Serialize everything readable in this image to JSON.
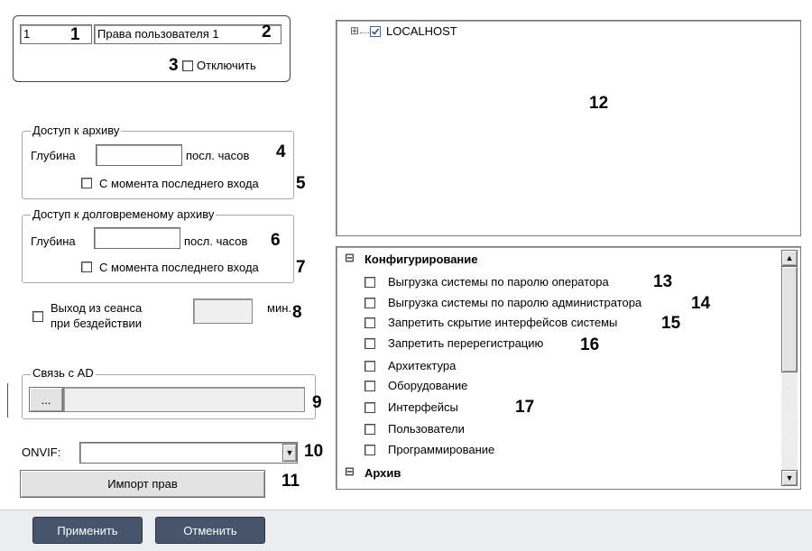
{
  "top": {
    "id_value": "1",
    "name_value": "Права пользователя 1",
    "disable_label": "Отключить"
  },
  "archive": {
    "legend": "Доступ к архиву",
    "depth_label": "Глубина",
    "depth_value": "",
    "hours_label": "посл. часов",
    "since_last_login": "С момента последнего входа"
  },
  "long_archive": {
    "legend": "Доступ к долговременому архиву",
    "depth_label": "Глубина",
    "depth_value": "",
    "hours_label": "посл. часов",
    "since_last_login": "С момента последнего входа"
  },
  "idle": {
    "label_line1": "Выход из сеанса",
    "label_line2": "при бездействии",
    "value": "",
    "unit": "мин."
  },
  "ad": {
    "legend": "Связь с AD",
    "browse_label": "...",
    "value": ""
  },
  "onvif": {
    "label": "ONVIF:",
    "value": "",
    "import_button": "Импорт прав"
  },
  "tree": {
    "root_label": "LOCALHOST",
    "expand_glyph": "⊞"
  },
  "permissions": {
    "groups": [
      {
        "label": "Конфигурирование",
        "toggle": "⊟"
      },
      {
        "label": "Архив",
        "toggle": "⊟"
      }
    ],
    "items": [
      "Выгрузка системы по паролю оператора",
      "Выгрузка системы по паролю администратора",
      "Запретить скрытие интерфейсов системы",
      "Запретить перерегистрацию",
      "Архитектура",
      "Оборудование",
      "Интерфейсы",
      "Пользователи",
      "Программирование"
    ]
  },
  "callouts": {
    "n1": "1",
    "n2": "2",
    "n3": "3",
    "n4": "4",
    "n5": "5",
    "n6": "6",
    "n7": "7",
    "n8": "8",
    "n9": "9",
    "n10": "10",
    "n11": "11",
    "n12": "12",
    "n13": "13",
    "n14": "14",
    "n15": "15",
    "n16": "16",
    "n17": "17"
  },
  "footer": {
    "apply": "Применить",
    "cancel": "Отменить"
  }
}
